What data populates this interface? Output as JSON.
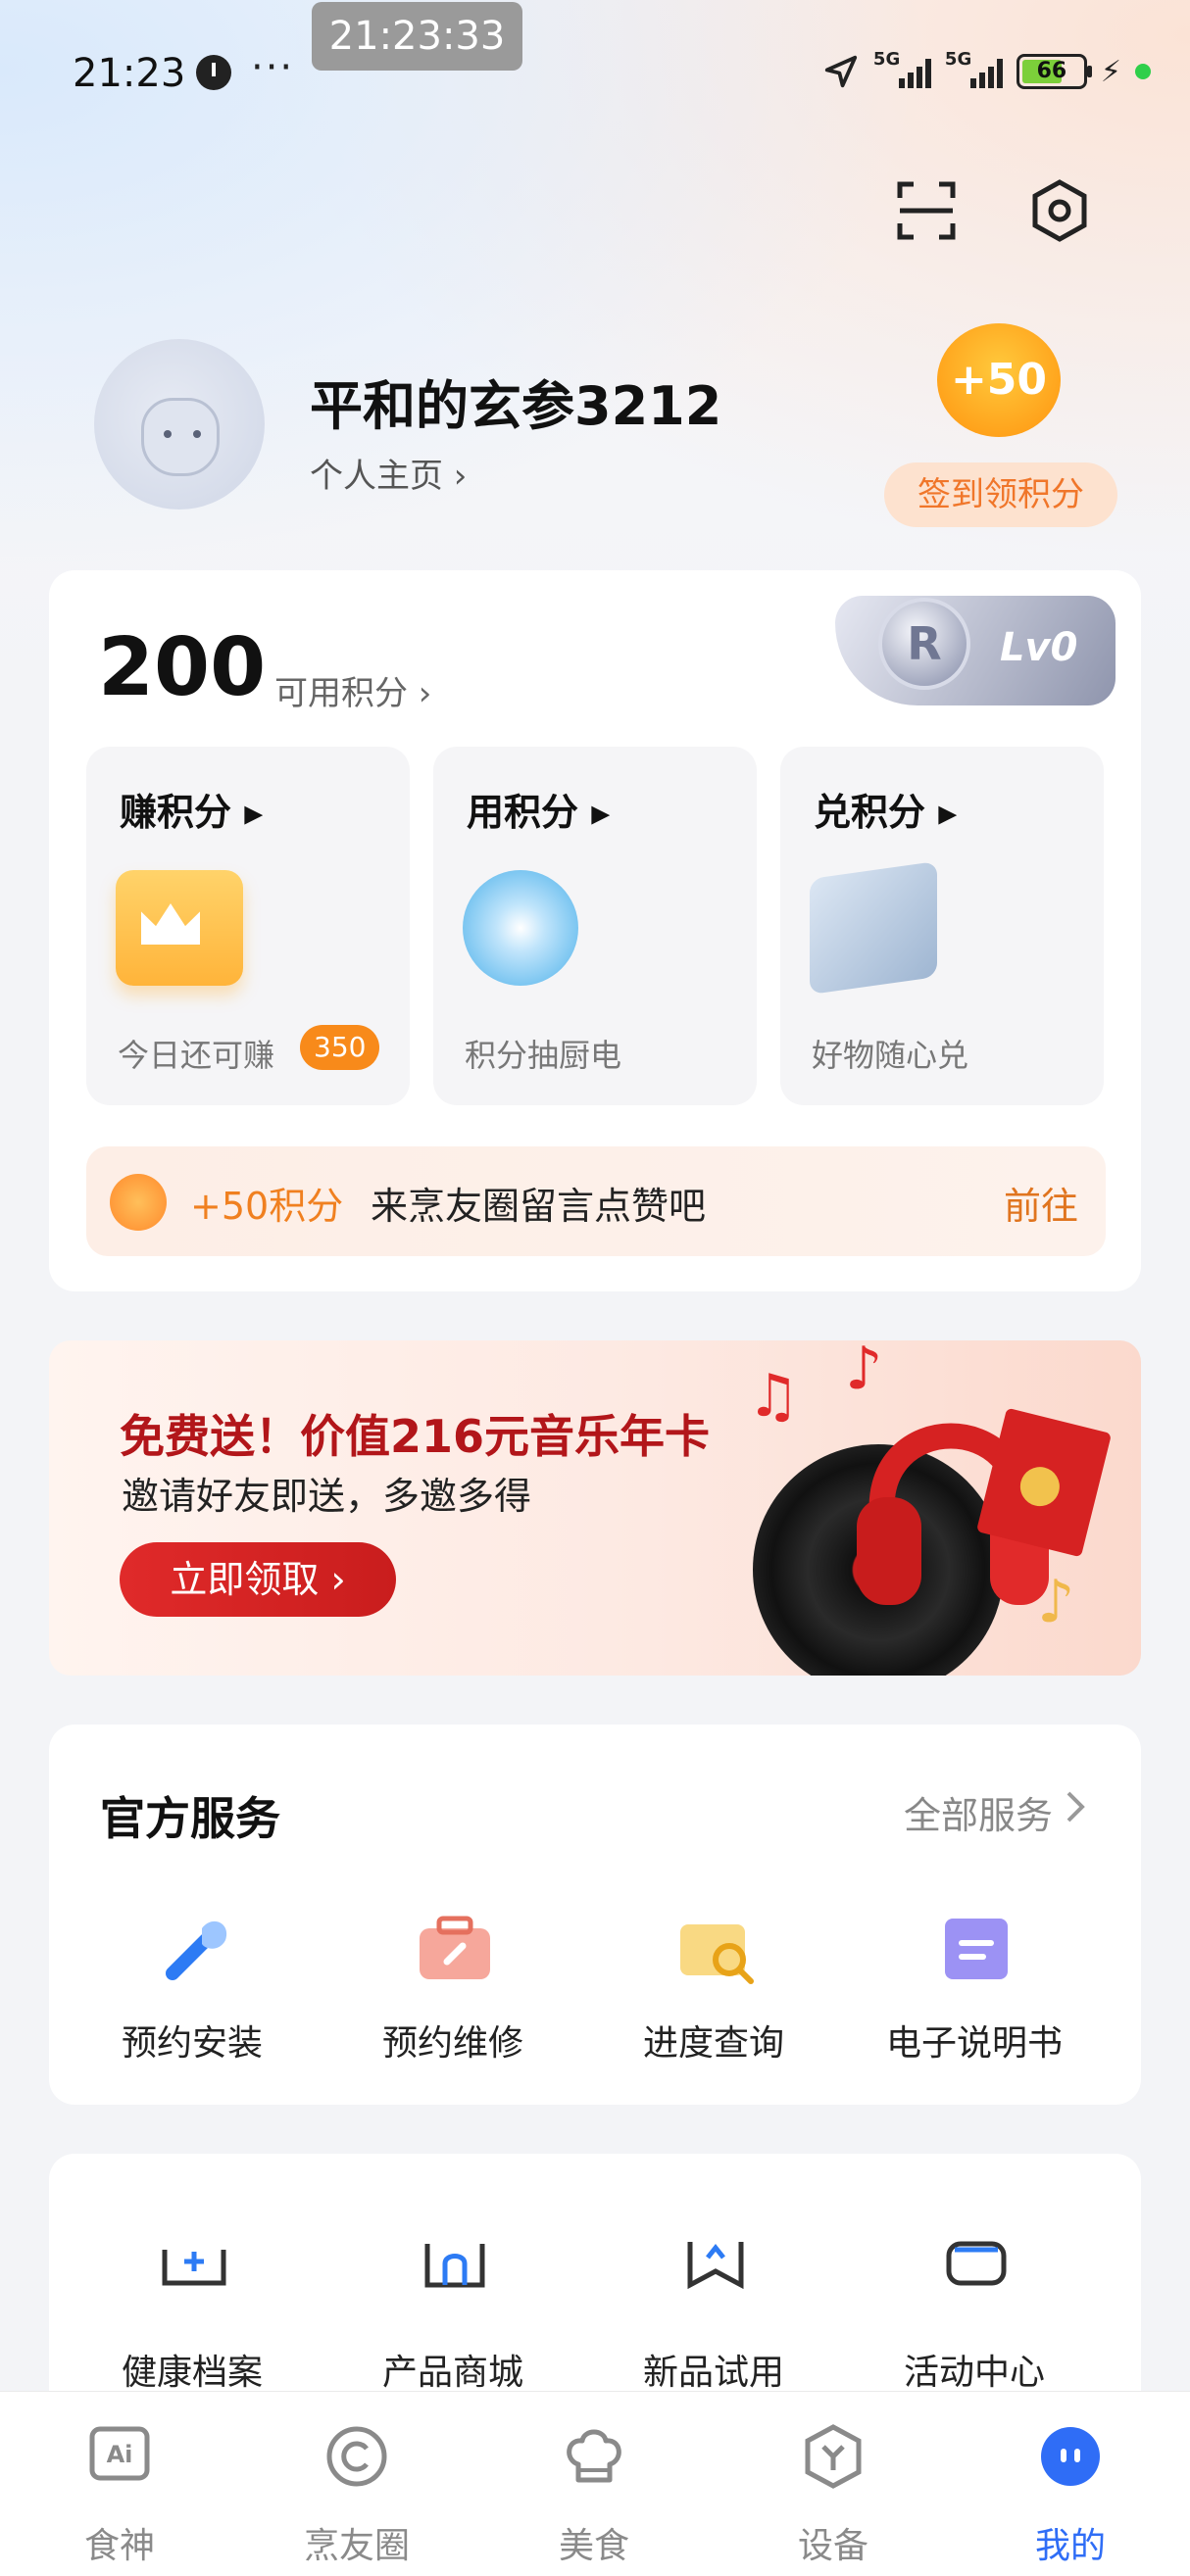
{
  "status_bar": {
    "time": "21:23",
    "overlay_time": "21:23:33",
    "more": "···",
    "network1": "5G",
    "network2": "5G",
    "battery": "66"
  },
  "profile": {
    "username": "平和的玄参3212",
    "homepage_link": "个人主页 ›",
    "checkin_reward": "+50",
    "checkin_button": "签到领积分"
  },
  "points": {
    "value": "200",
    "label": "可用积分 ›",
    "level": "Lv0",
    "level_emblem": "R",
    "tiles": [
      {
        "title": "赚积分 ▸",
        "subtitle": "今日还可赚",
        "badge": "350"
      },
      {
        "title": "用积分 ▸",
        "subtitle": "积分抽厨电"
      },
      {
        "title": "兑积分 ▸",
        "subtitle": "好物随心兑"
      }
    ],
    "promo": {
      "points": "+50积分",
      "text": "来烹友圈留言点赞吧",
      "action": "前往"
    }
  },
  "banner": {
    "title": "免费送！价值216元音乐年卡",
    "subtitle": "邀请好友即送，多邀多得",
    "button": "立即领取 ›"
  },
  "services": {
    "title": "官方服务",
    "all_label": "全部服务",
    "items": [
      {
        "label": "预约安装",
        "icon": "install-icon"
      },
      {
        "label": "预约维修",
        "icon": "repair-icon"
      },
      {
        "label": "进度查询",
        "icon": "progress-search-icon"
      },
      {
        "label": "电子说明书",
        "icon": "manual-icon"
      }
    ]
  },
  "tools": {
    "items": [
      {
        "label": "健康档案",
        "icon": "health-record-icon"
      },
      {
        "label": "产品商城",
        "icon": "store-icon"
      },
      {
        "label": "新品试用",
        "icon": "trial-icon"
      },
      {
        "label": "活动中心",
        "icon": "activity-icon"
      }
    ]
  },
  "tabbar": {
    "items": [
      {
        "label": "食神",
        "icon": "ai-chef-icon"
      },
      {
        "label": "烹友圈",
        "icon": "circle-icon"
      },
      {
        "label": "美食",
        "icon": "chef-hat-icon"
      },
      {
        "label": "设备",
        "icon": "device-icon"
      },
      {
        "label": "我的",
        "icon": "profile-icon",
        "active": true
      }
    ],
    "active_color": "#2f6df6"
  },
  "colors": {
    "accent_orange": "#f08020",
    "banner_red": "#c91d1d",
    "active_blue": "#2f6df6"
  }
}
